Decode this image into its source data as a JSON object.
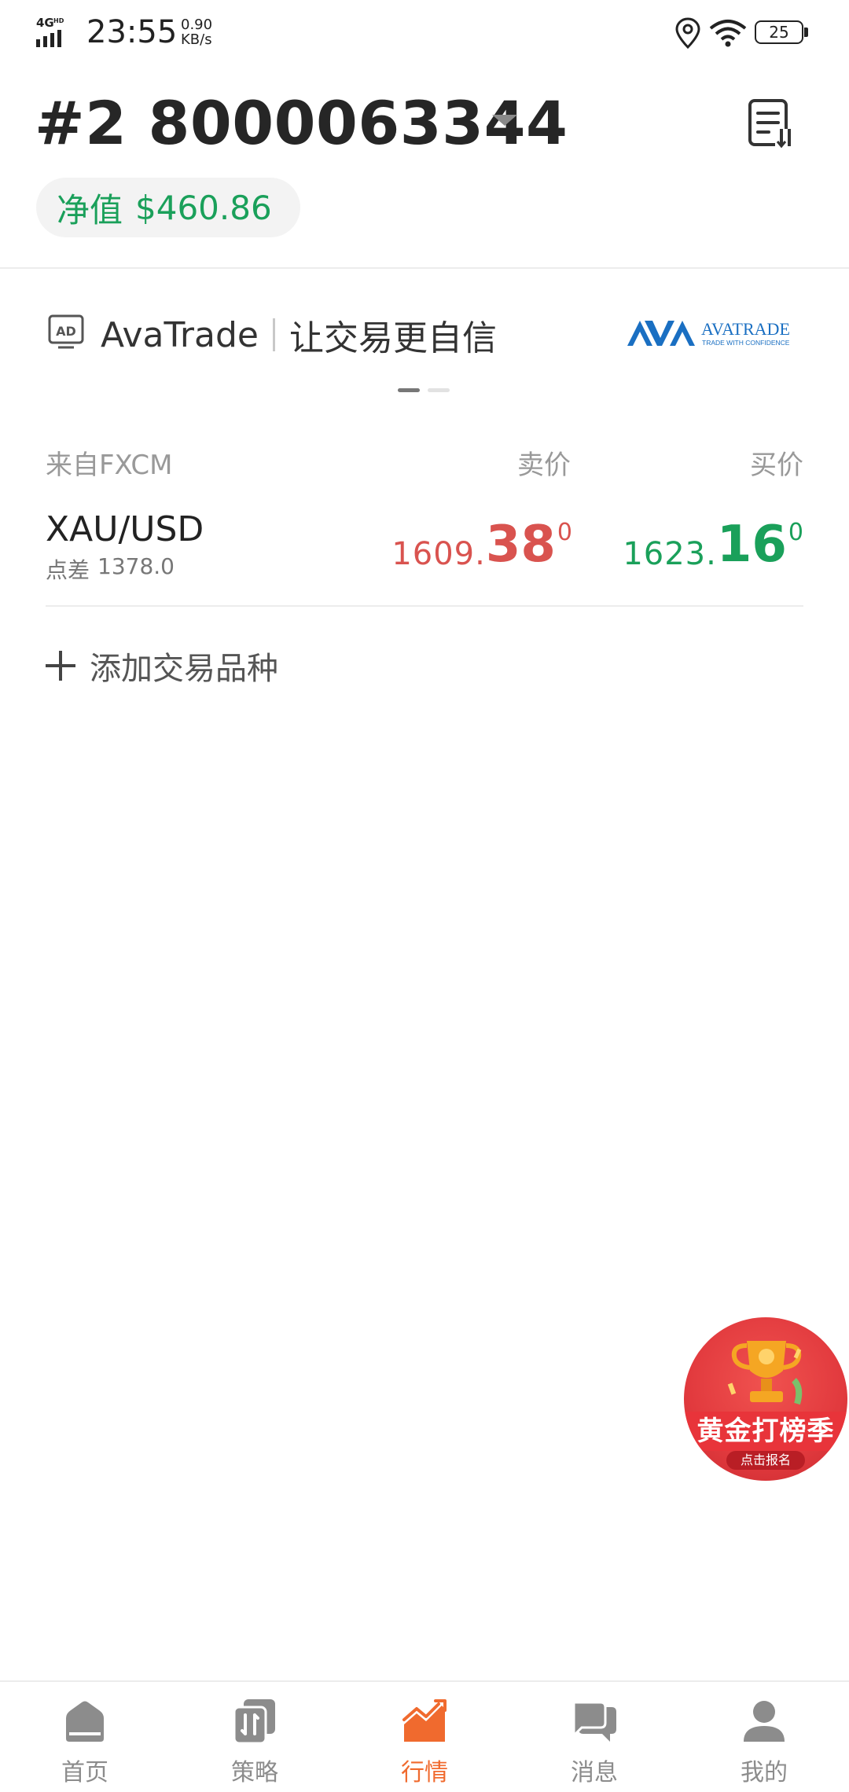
{
  "status_bar": {
    "network": "4G HD",
    "time": "23:55",
    "speed_value": "0.90",
    "speed_unit": "KB/s",
    "battery": "25"
  },
  "header": {
    "account": "#2 8000063344",
    "equity_label": "净值",
    "equity_value": "$460.86"
  },
  "ad": {
    "badge": "AD",
    "brand": "AvaTrade",
    "slogan": "让交易更自信",
    "logo_text": "AVATRADE",
    "logo_tagline": "TRADE WITH CONFIDENCE",
    "page_index": 1,
    "page_count": 2
  },
  "quotes": {
    "source_label": "来自FXCM",
    "sell_label": "卖价",
    "buy_label": "买价",
    "rows": [
      {
        "symbol": "XAU/USD",
        "spread_label": "点差",
        "spread_value": "1378.0",
        "sell": {
          "base": "1609.",
          "big": "38",
          "pip": "0"
        },
        "buy": {
          "base": "1623.",
          "big": "16",
          "pip": "0"
        }
      }
    ]
  },
  "add_symbol_label": "添加交易品种",
  "promo": {
    "title": "黄金打榜季",
    "subtitle": "点击报名"
  },
  "bottom_nav": [
    {
      "label": "首页",
      "icon": "home-icon",
      "active": false
    },
    {
      "label": "策略",
      "icon": "strategy-icon",
      "active": false
    },
    {
      "label": "行情",
      "icon": "market-chart-icon",
      "active": true
    },
    {
      "label": "消息",
      "icon": "message-icon",
      "active": false
    },
    {
      "label": "我的",
      "icon": "profile-icon",
      "active": false
    }
  ],
  "colors": {
    "sell": "#d9534f",
    "buy": "#1aa05a",
    "accent": "#f06a2e",
    "equity": "#1aa05a"
  }
}
